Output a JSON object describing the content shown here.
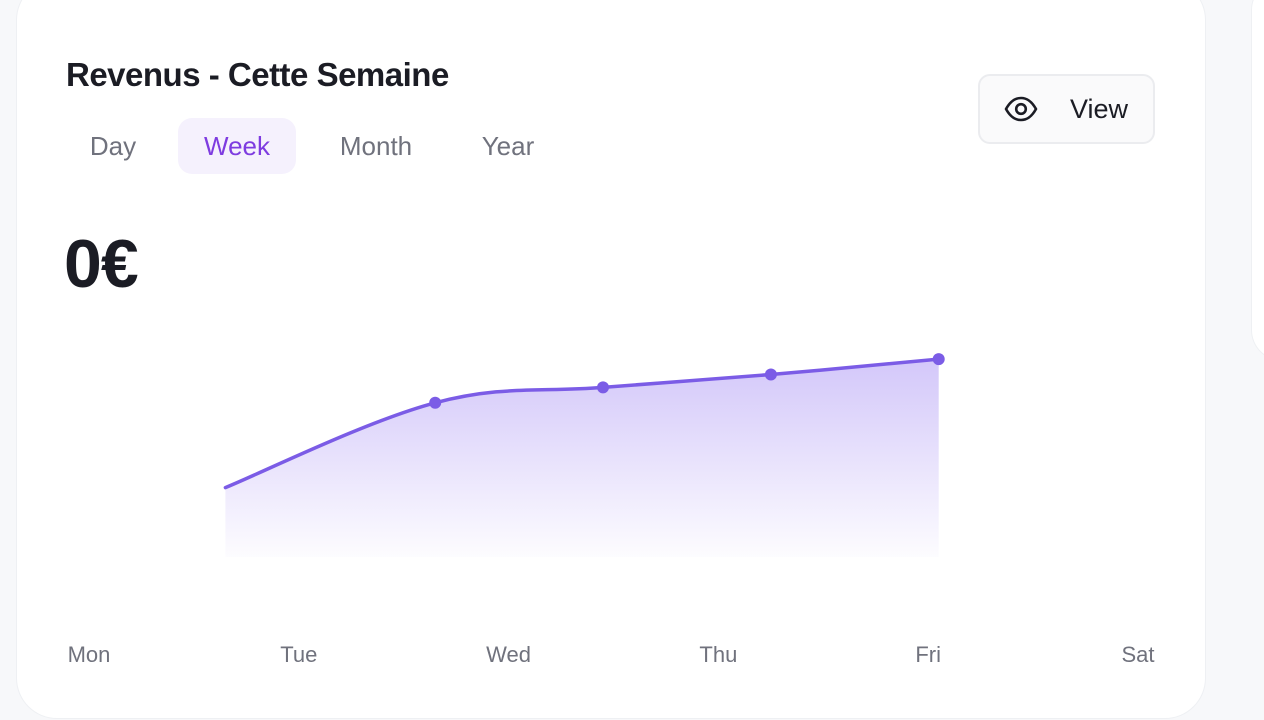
{
  "header": {
    "title": "Revenus - Cette Semaine"
  },
  "tabs": [
    {
      "label": "Day",
      "active": false
    },
    {
      "label": "Week",
      "active": true
    },
    {
      "label": "Month",
      "active": false
    },
    {
      "label": "Year",
      "active": false
    }
  ],
  "view_button": {
    "label": "View",
    "icon": "eye-icon"
  },
  "summary": {
    "amount": "0€"
  },
  "colors": {
    "accent": "#7e3ce0",
    "line": "#7b5ce6",
    "tab_active_bg": "#f5f1fd",
    "text_dark": "#1b1c24",
    "text_muted": "#70727d"
  },
  "chart_data": {
    "type": "area",
    "categories": [
      "Mon",
      "Tue",
      "Wed",
      "Thu",
      "Fri",
      "Sat"
    ],
    "x": [
      0.65,
      1.65,
      2.45,
      3.25,
      4.05
    ],
    "values": [
      0.27,
      0.6,
      0.66,
      0.71,
      0.77
    ],
    "markers_at": [
      1,
      2,
      3,
      4
    ],
    "ylim": [
      0,
      1
    ],
    "grid": false,
    "legend": "none"
  }
}
